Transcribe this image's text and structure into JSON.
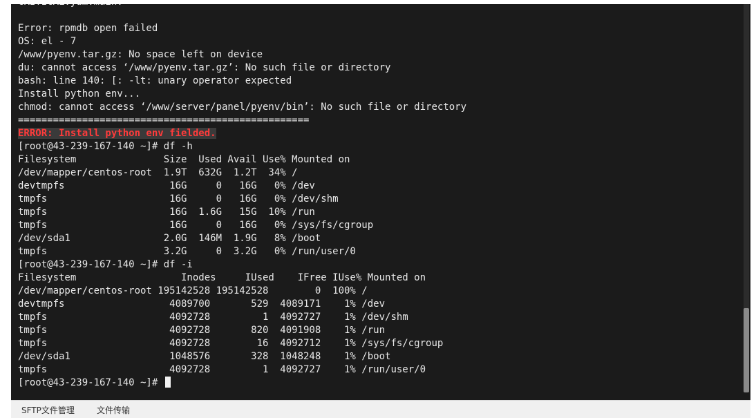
{
  "terminal": {
    "lines": [
      {
        "text": "CRITICAL:yum.main:",
        "style": "normal"
      },
      {
        "text": "",
        "style": "normal"
      },
      {
        "text": "Error: rpmdb open failed",
        "style": "normal"
      },
      {
        "text": "OS: el - 7",
        "style": "normal"
      },
      {
        "text": "/www/pyenv.tar.gz: No space left on device",
        "style": "normal"
      },
      {
        "text": "du: cannot access ‘/www/pyenv.tar.gz’: No such file or directory",
        "style": "normal"
      },
      {
        "text": "bash: line 140: [: -lt: unary operator expected",
        "style": "normal"
      },
      {
        "text": "Install python env...",
        "style": "normal"
      },
      {
        "text": "chmod: cannot access ‘/www/server/panel/pyenv/bin’: No such file or directory",
        "style": "normal"
      },
      {
        "text": "==================================================",
        "style": "normal"
      },
      {
        "text": "ERROR: Install python env fielded.",
        "style": "error"
      },
      {
        "text": "[root@43-239-167-140 ~]# df -h",
        "style": "normal"
      },
      {
        "text": "Filesystem               Size  Used Avail Use% Mounted on",
        "style": "normal"
      },
      {
        "text": "/dev/mapper/centos-root  1.9T  632G  1.2T  34% /",
        "style": "normal"
      },
      {
        "text": "devtmpfs                  16G     0   16G   0% /dev",
        "style": "normal"
      },
      {
        "text": "tmpfs                     16G     0   16G   0% /dev/shm",
        "style": "normal"
      },
      {
        "text": "tmpfs                     16G  1.6G   15G  10% /run",
        "style": "normal"
      },
      {
        "text": "tmpfs                     16G     0   16G   0% /sys/fs/cgroup",
        "style": "normal"
      },
      {
        "text": "/dev/sda1                2.0G  146M  1.9G   8% /boot",
        "style": "normal"
      },
      {
        "text": "tmpfs                    3.2G     0  3.2G   0% /run/user/0",
        "style": "normal"
      },
      {
        "text": "[root@43-239-167-140 ~]# df -i",
        "style": "normal"
      },
      {
        "text": "Filesystem                  Inodes     IUsed    IFree IUse% Mounted on",
        "style": "normal"
      },
      {
        "text": "/dev/mapper/centos-root 195142528 195142528        0  100% /",
        "style": "normal"
      },
      {
        "text": "devtmpfs                  4089700       529  4089171    1% /dev",
        "style": "normal"
      },
      {
        "text": "tmpfs                     4092728         1  4092727    1% /dev/shm",
        "style": "normal"
      },
      {
        "text": "tmpfs                     4092728       820  4091908    1% /run",
        "style": "normal"
      },
      {
        "text": "tmpfs                     4092728        16  4092712    1% /sys/fs/cgroup",
        "style": "normal"
      },
      {
        "text": "/dev/sda1                 1048576       328  1048248    1% /boot",
        "style": "normal"
      },
      {
        "text": "tmpfs                     4092728         1  4092727    1% /run/user/0",
        "style": "normal"
      },
      {
        "text": "[root@43-239-167-140 ~]# ",
        "style": "prompt"
      }
    ],
    "background": "#1b1b1b",
    "foreground": "#e8e8e8",
    "error_color": "#ff3b3b"
  },
  "bottom_bar": {
    "sftp_label": "SFTP文件管理",
    "transfer_label": "文件传输"
  }
}
